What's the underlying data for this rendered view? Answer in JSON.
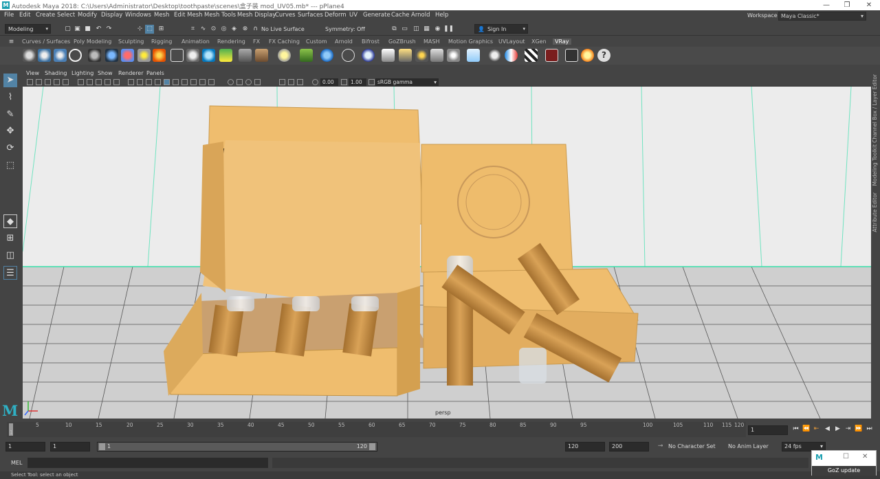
{
  "window": {
    "title": "Autodesk Maya 2018: C:\\Users\\Administrator\\Desktop\\toothpaste\\scenes\\盒子装 mod_UV05.mb*   ---   pPlane4",
    "minimize": "—",
    "restore": "❐",
    "close": "✕"
  },
  "menu": [
    "File",
    "Edit",
    "Create",
    "Select",
    "Modify",
    "Display",
    "Windows",
    "Mesh",
    "Edit Mesh",
    "Mesh Tools",
    "Mesh Display",
    "Curves",
    "Surfaces",
    "Deform",
    "UV",
    "Generate",
    "Cache",
    "Arnold",
    "Help"
  ],
  "workspace": {
    "label": "Workspace :",
    "value": "Maya Classic*"
  },
  "status": {
    "mode": "Modeling",
    "live_surface": "No Live Surface",
    "symmetry": "Symmetry: Off",
    "sign_in": "Sign In"
  },
  "shelf_tabs": [
    "Curves / Surfaces",
    "Poly Modeling",
    "Sculpting",
    "Rigging",
    "Animation",
    "Rendering",
    "FX",
    "FX Caching",
    "Custom",
    "Arnold",
    "Bifrost",
    "GoZBrush",
    "MASH",
    "Motion Graphics",
    "UVLayout",
    "XGen",
    "VRay"
  ],
  "active_shelf_tab": "VRay",
  "panel_menu": [
    "View",
    "Shading",
    "Lighting",
    "Show",
    "Renderer",
    "Panels"
  ],
  "panel_toolbar": {
    "exposure": "0.00",
    "gamma": "1.00",
    "color_space": "sRGB gamma"
  },
  "viewport": {
    "camera_label": "persp"
  },
  "side_tabs": [
    "Channel Box / Layer Editor",
    "Modeling Toolkit",
    "Attribute Editor"
  ],
  "timeline": {
    "ticks": [
      "1",
      "5",
      "10",
      "15",
      "20",
      "25",
      "30",
      "35",
      "40",
      "45",
      "50",
      "55",
      "60",
      "65",
      "70",
      "75",
      "80",
      "85",
      "90",
      "95",
      "100",
      "105",
      "110",
      "115",
      "120"
    ],
    "current_frame": "1"
  },
  "range": {
    "start": "1",
    "playback_start": "1",
    "slider_start": "1",
    "slider_end": "120",
    "playback_end": "120",
    "end": "200",
    "character_set": "No Character Set",
    "anim_layer": "No Anim Layer",
    "fps": "24 fps"
  },
  "mel": {
    "label": "MEL"
  },
  "help_line": "Select Tool: select an object",
  "goz": {
    "label": "GoZ update",
    "logo": "M"
  },
  "colors": {
    "accent": "#5283a5",
    "box": "#efbd6e",
    "grid_axis": "#4fe0b0",
    "maya_logo": "#2fb0c4"
  }
}
